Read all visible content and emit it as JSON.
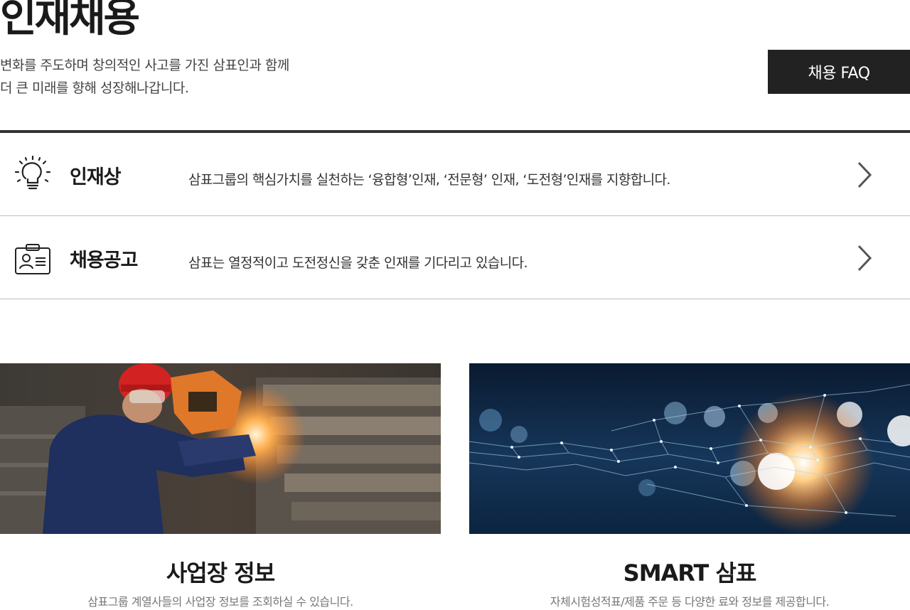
{
  "page": {
    "title": "인재채용",
    "intro_line1": "변화를 주도하며 창의적인 사고를 가진 삼표인과 함께",
    "intro_line2": "더 큰 미래를 향해 성장해나갑니다."
  },
  "faq_button": {
    "label": "채용 FAQ"
  },
  "rows": [
    {
      "icon": "lightbulb-icon",
      "title": "인재상",
      "description": "삼표그룹의 핵심가치를 실천하는 ‘융합형’인재, ‘전문형’ 인재, ‘도전형’인재를 지향합니다."
    },
    {
      "icon": "id-card-icon",
      "title": "채용공고",
      "description": "삼표는 열정적이고 도전정신을 갖춘 인재를 기다리고 있습니다."
    }
  ],
  "cards": [
    {
      "image": "welding-worker-photo",
      "title": "사업장 정보",
      "description": "삼표그룹 계열사들의 사업장 정보를 조회하실 수 있습니다."
    },
    {
      "image": "network-mesh-photo",
      "title": "SMART 삼표",
      "description": "자체시험성적표/제품 주문 등 다양한 료와 정보를 제공합니다."
    }
  ],
  "colors": {
    "faq_bg": "#222222",
    "divider": "#333333",
    "row_border": "#bdbdbd",
    "muted_text": "#777777"
  }
}
